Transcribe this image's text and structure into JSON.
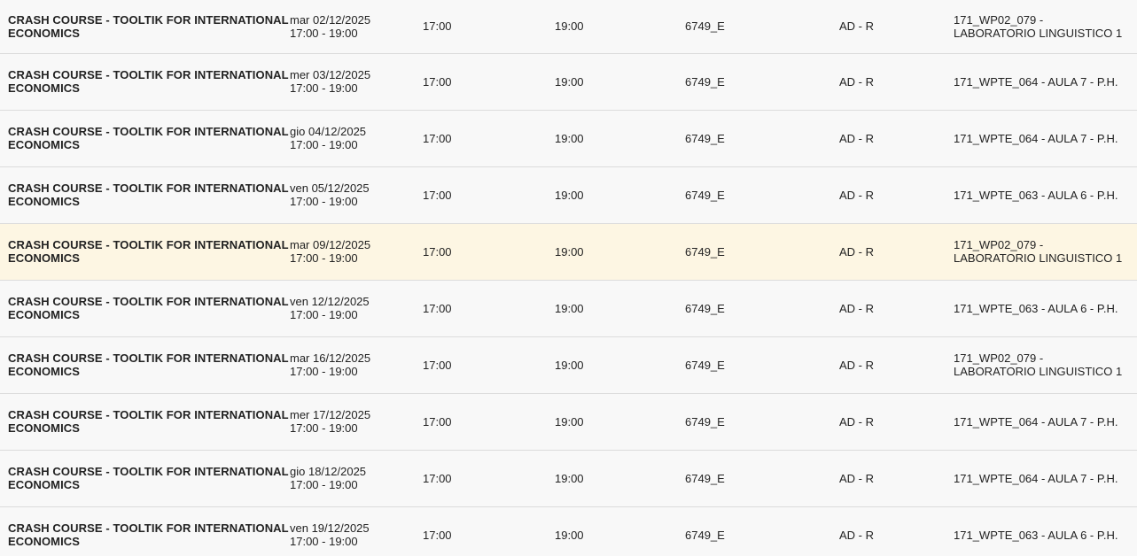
{
  "rows": [
    {
      "course_line1": "CRASH COURSE - TOOLTIK FOR INTERNATIONAL",
      "course_line2": "ECONOMICS",
      "date": "mar 02/12/2025",
      "time_range": "17:00 - 19:00",
      "start": "17:00",
      "end": "19:00",
      "code": "6749_E",
      "type": "AD - R",
      "room_line1": "171_WP02_079 -",
      "room_line2": "LABORATORIO LINGUISTICO 1",
      "highlight": false
    },
    {
      "course_line1": "CRASH COURSE - TOOLTIK FOR INTERNATIONAL",
      "course_line2": "ECONOMICS",
      "date": "mer 03/12/2025",
      "time_range": "17:00 - 19:00",
      "start": "17:00",
      "end": "19:00",
      "code": "6749_E",
      "type": "AD - R",
      "room_line1": "171_WPTE_064 - AULA 7 - P.H.",
      "room_line2": "",
      "highlight": false
    },
    {
      "course_line1": "CRASH COURSE - TOOLTIK FOR INTERNATIONAL",
      "course_line2": "ECONOMICS",
      "date": "gio 04/12/2025",
      "time_range": "17:00 - 19:00",
      "start": "17:00",
      "end": "19:00",
      "code": "6749_E",
      "type": "AD - R",
      "room_line1": "171_WPTE_064 - AULA 7 - P.H.",
      "room_line2": "",
      "highlight": false
    },
    {
      "course_line1": "CRASH COURSE - TOOLTIK FOR INTERNATIONAL",
      "course_line2": "ECONOMICS",
      "date": "ven 05/12/2025",
      "time_range": "17:00 - 19:00",
      "start": "17:00",
      "end": "19:00",
      "code": "6749_E",
      "type": "AD - R",
      "room_line1": "171_WPTE_063 - AULA 6 - P.H.",
      "room_line2": "",
      "highlight": false
    },
    {
      "course_line1": "CRASH COURSE - TOOLTIK FOR INTERNATIONAL",
      "course_line2": "ECONOMICS",
      "date": "mar 09/12/2025",
      "time_range": "17:00 - 19:00",
      "start": "17:00",
      "end": "19:00",
      "code": "6749_E",
      "type": "AD - R",
      "room_line1": "171_WP02_079 -",
      "room_line2": "LABORATORIO LINGUISTICO 1",
      "highlight": true
    },
    {
      "course_line1": "CRASH COURSE - TOOLTIK FOR INTERNATIONAL",
      "course_line2": "ECONOMICS",
      "date": "ven 12/12/2025",
      "time_range": "17:00 - 19:00",
      "start": "17:00",
      "end": "19:00",
      "code": "6749_E",
      "type": "AD - R",
      "room_line1": "171_WPTE_063 - AULA 6 - P.H.",
      "room_line2": "",
      "highlight": false
    },
    {
      "course_line1": "CRASH COURSE - TOOLTIK FOR INTERNATIONAL",
      "course_line2": "ECONOMICS",
      "date": "mar 16/12/2025",
      "time_range": "17:00 - 19:00",
      "start": "17:00",
      "end": "19:00",
      "code": "6749_E",
      "type": "AD - R",
      "room_line1": "171_WP02_079 -",
      "room_line2": "LABORATORIO LINGUISTICO 1",
      "highlight": false
    },
    {
      "course_line1": "CRASH COURSE - TOOLTIK FOR INTERNATIONAL",
      "course_line2": "ECONOMICS",
      "date": "mer 17/12/2025",
      "time_range": "17:00 - 19:00",
      "start": "17:00",
      "end": "19:00",
      "code": "6749_E",
      "type": "AD - R",
      "room_line1": "171_WPTE_064 - AULA 7 - P.H.",
      "room_line2": "",
      "highlight": false
    },
    {
      "course_line1": "CRASH COURSE - TOOLTIK FOR INTERNATIONAL",
      "course_line2": "ECONOMICS",
      "date": "gio 18/12/2025",
      "time_range": "17:00 - 19:00",
      "start": "17:00",
      "end": "19:00",
      "code": "6749_E",
      "type": "AD - R",
      "room_line1": "171_WPTE_064 - AULA 7 - P.H.",
      "room_line2": "",
      "highlight": false
    },
    {
      "course_line1": "CRASH COURSE - TOOLTIK FOR INTERNATIONAL",
      "course_line2": "ECONOMICS",
      "date": "ven 19/12/2025",
      "time_range": "17:00 - 19:00",
      "start": "17:00",
      "end": "19:00",
      "code": "6749_E",
      "type": "AD - R",
      "room_line1": "171_WPTE_063 - AULA 6 - P.H.",
      "room_line2": "",
      "highlight": false
    }
  ],
  "colors": {
    "row_background": "#f8f8f8",
    "highlight_background": "#fdf6e3",
    "divider": "#dcdcdc",
    "text": "#222222"
  }
}
